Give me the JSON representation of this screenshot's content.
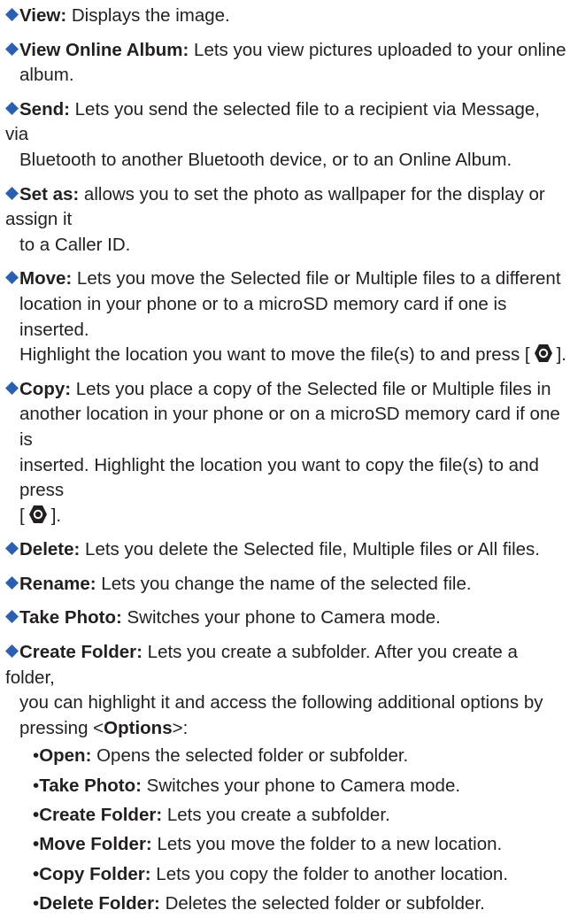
{
  "colors": {
    "diamond": "#2b5fb4",
    "text": "#231f20",
    "nav_key": "#231f20"
  },
  "icons": {
    "item_marker": "diamond-bullet-icon",
    "nav_key": "navigation-key-icon"
  },
  "items": [
    {
      "term": "View:",
      "text": " Displays the image."
    },
    {
      "term": "View Online Album:",
      "text": " Lets you view pictures uploaded to your online",
      "cont": "album."
    },
    {
      "term": "Send:",
      "text": " Lets you send the selected file to a recipient via Message, via",
      "cont": "Bluetooth to another Bluetooth device, or to an Online Album."
    },
    {
      "term": "Set as:",
      "text": " allows you to set the photo as wallpaper for the display or assign it",
      "cont": "to a Caller ID."
    },
    {
      "term": "Move:",
      "text": " Lets you move the Selected file or Multiple files to a different",
      "cont": "location in your phone or to a microSD memory card if one is inserted.",
      "cont2_pre": "Highlight the location you want to move the file(s) to and press [",
      "cont2_post": "]."
    },
    {
      "term": "Copy:",
      "text": " Lets you place a copy of the Selected file or Multiple files in",
      "cont": "another location in your phone or on a microSD memory card if one is",
      "cont2": "inserted. Highlight the location you want to copy the file(s) to and press",
      "cont3_pre": "[",
      "cont3_post": "]."
    },
    {
      "term": "Delete:",
      "text": " Lets you delete the Selected file, Multiple files or All files."
    },
    {
      "term": "Rename:",
      "text": " Lets you change the name of the selected file."
    },
    {
      "term": "Take Photo:",
      "text": " Switches your phone to Camera mode."
    },
    {
      "term": "Create Folder:",
      "text": " Lets you create a subfolder. After you create a folder,",
      "cont": "you can highlight it and access the following additional options by",
      "cont2_pre": "pressing <",
      "cont2_bold": "Options",
      "cont2_post": ">:"
    }
  ],
  "subitems": [
    {
      "bullet": "•",
      "term": "Open:",
      "text": " Opens the selected folder or subfolder."
    },
    {
      "bullet": "•",
      "term": "Take Photo:",
      "text": " Switches your phone to Camera mode."
    },
    {
      "bullet": "•",
      "term": "Create Folder:",
      "text": " Lets you create a subfolder."
    },
    {
      "bullet": "•",
      "term": "Move Folder:",
      "text": " Lets you move the folder to a new location."
    },
    {
      "bullet": "•",
      "term": "Copy Folder:",
      "text": " Lets you copy the folder to another location."
    },
    {
      "bullet": "•",
      "term": "Delete Folder:",
      "text": " Deletes the selected folder or subfolder."
    }
  ]
}
